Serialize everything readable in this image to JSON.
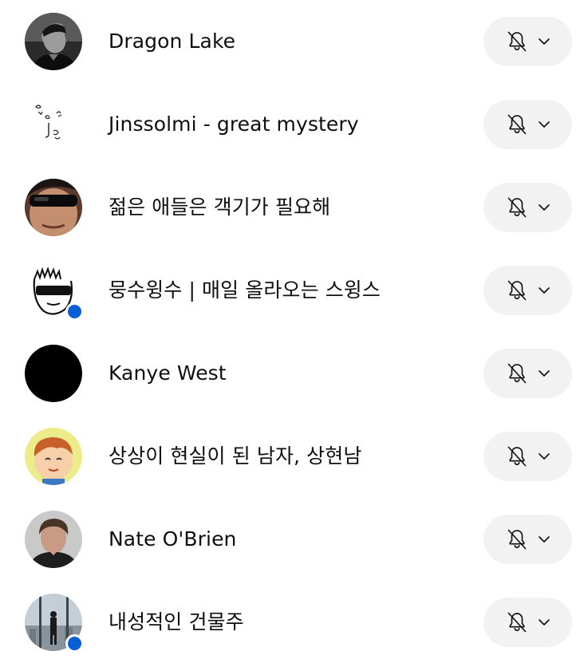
{
  "subscriptions": [
    {
      "name": "Dragon Lake",
      "avatar_icon": "photo-man-dark",
      "has_new": false,
      "notification_icon": "bell-off-icon"
    },
    {
      "name": "Jinssolmi - great mystery",
      "avatar_icon": "doodle-face",
      "has_new": false,
      "notification_icon": "bell-off-icon"
    },
    {
      "name": "젊은 애들은 객기가 필요해",
      "avatar_icon": "photo-sunglasses-man",
      "has_new": false,
      "notification_icon": "bell-off-icon"
    },
    {
      "name": "뭉수윙수 | 매일 올라오는 스윙스",
      "avatar_icon": "cartoon-sunglasses",
      "has_new": true,
      "notification_icon": "bell-off-icon"
    },
    {
      "name": "Kanye West",
      "avatar_icon": "black-circle",
      "has_new": false,
      "notification_icon": "bell-off-icon"
    },
    {
      "name": "상상이 현실이 된 남자, 상현남",
      "avatar_icon": "cartoon-boy",
      "has_new": false,
      "notification_icon": "bell-off-icon"
    },
    {
      "name": "Nate O'Brien",
      "avatar_icon": "photo-young-man",
      "has_new": false,
      "notification_icon": "bell-off-icon"
    },
    {
      "name": "내성적인 건물주",
      "avatar_icon": "photo-city-window",
      "has_new": true,
      "notification_icon": "bell-off-icon"
    }
  ],
  "colors": {
    "pill_background": "#f2f2f2",
    "new_dot": "#065fd4",
    "text": "#0f0f0f"
  }
}
